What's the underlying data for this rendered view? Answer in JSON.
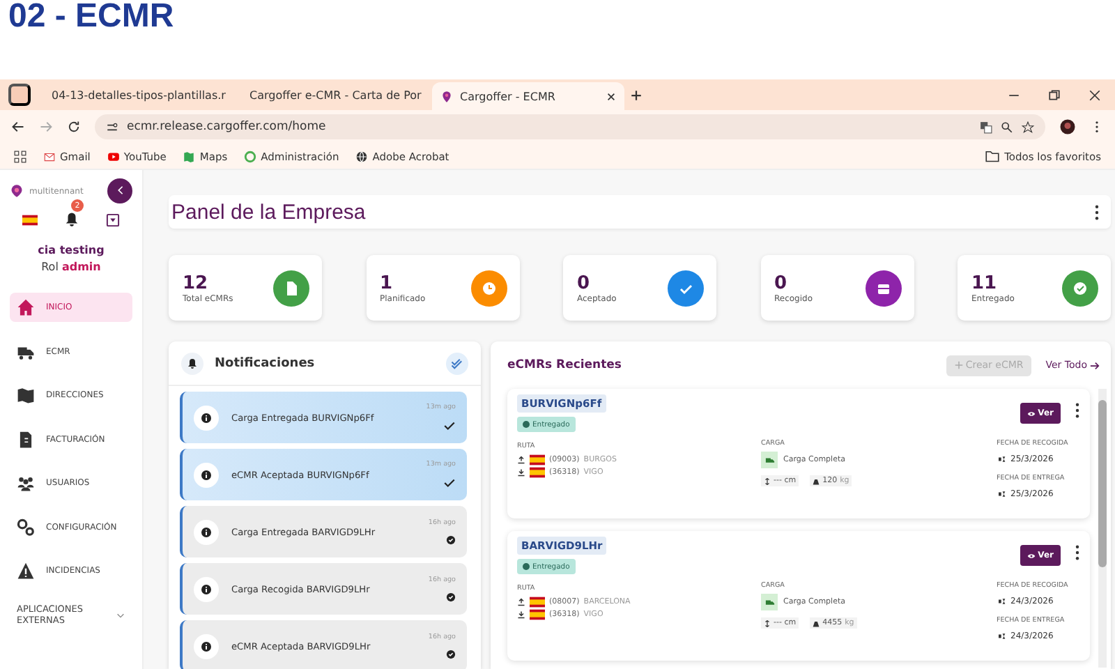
{
  "slide_title": "02 - ECMR",
  "browser": {
    "tabs": [
      {
        "title": "04-13-detalles-tipos-plantillas.r",
        "selected": false,
        "kind": "doc"
      },
      {
        "title": "Cargoffer e-CMR - Carta de Por",
        "selected": false,
        "kind": "app"
      },
      {
        "title": "Cargoffer - ECMR",
        "selected": true,
        "kind": "app"
      }
    ],
    "url": "ecmr.release.cargoffer.com/home",
    "bookmarks": [
      {
        "label": "Gmail",
        "kind": "gmail"
      },
      {
        "label": "YouTube",
        "kind": "youtube"
      },
      {
        "label": "Maps",
        "kind": "maps"
      },
      {
        "label": "Administración",
        "kind": "admin"
      },
      {
        "label": "Adobe Acrobat",
        "kind": "globe"
      }
    ],
    "all_bookmarks": "Todos los favoritos"
  },
  "sidebar": {
    "tenant": "multitennant",
    "notification_count": "2",
    "company": "cia testing",
    "role_label": "Rol",
    "role": "admin",
    "items": [
      {
        "label": "INICIO",
        "selected": true
      },
      {
        "label": "ECMR",
        "selected": false
      },
      {
        "label": "DIRECCIONES",
        "selected": false
      },
      {
        "label": "FACTURACIÓN",
        "selected": false
      },
      {
        "label": "USUARIOS",
        "selected": false
      },
      {
        "label": "CONFIGURACIÓN",
        "selected": false
      },
      {
        "label": "INCIDENCIAS",
        "selected": false
      }
    ],
    "external": "APLICACIONES EXTERNAS"
  },
  "page_title": "Panel de la Empresa",
  "stats": [
    {
      "value": "12",
      "label": "Total eCMRs",
      "color": "#43a047"
    },
    {
      "value": "1",
      "label": "Planificado",
      "color": "#fb8c00"
    },
    {
      "value": "0",
      "label": "Aceptado",
      "color": "#1e88e5"
    },
    {
      "value": "0",
      "label": "Recogido",
      "color": "#8e24aa"
    },
    {
      "value": "11",
      "label": "Entregado",
      "color": "#43a047"
    }
  ],
  "notifications": {
    "title": "Notificaciones",
    "items": [
      {
        "text": "Carga Entregada BURVIGNp6Ff",
        "time": "13m ago",
        "unread": true
      },
      {
        "text": "eCMR Aceptada BURVIGNp6Ff",
        "time": "13m ago",
        "unread": true
      },
      {
        "text": "Carga Entregada BARVIGD9LHr",
        "time": "16h ago",
        "unread": false
      },
      {
        "text": "Carga Recogida BARVIGD9LHr",
        "time": "16h ago",
        "unread": false
      },
      {
        "text": "eCMR Aceptada BARVIGD9LHr",
        "time": "16h ago",
        "unread": false
      }
    ]
  },
  "recent": {
    "title": "eCMRs Recientes",
    "create": "Crear eCMR",
    "view_all": "Ver Todo",
    "items": [
      {
        "code": "BURVIGNp6Ff",
        "status": "Entregado",
        "view": "Ver",
        "route_label": "RUTA",
        "origin_zip": "(09003)",
        "origin": "BURGOS",
        "dest_zip": "(36318)",
        "dest": "VIGO",
        "cargo_label": "CARGA",
        "cargo": "Carga Completa",
        "length": "--- cm",
        "weight": "120",
        "weight_unit": "kg",
        "pickup_label": "FECHA DE RECOGIDA",
        "pickup": "25/3/2026",
        "delivery_label": "FECHA DE ENTREGA",
        "delivery": "25/3/2026"
      },
      {
        "code": "BARVIGD9LHr",
        "status": "Entregado",
        "view": "Ver",
        "route_label": "RUTA",
        "origin_zip": "(08007)",
        "origin": "BARCELONA",
        "dest_zip": "(36318)",
        "dest": "VIGO",
        "cargo_label": "CARGA",
        "cargo": "Carga Completa",
        "length": "--- cm",
        "weight": "4455",
        "weight_unit": "kg",
        "pickup_label": "FECHA DE RECOGIDA",
        "pickup": "24/3/2026",
        "delivery_label": "FECHA DE ENTREGA",
        "delivery": "24/3/2026"
      }
    ]
  }
}
